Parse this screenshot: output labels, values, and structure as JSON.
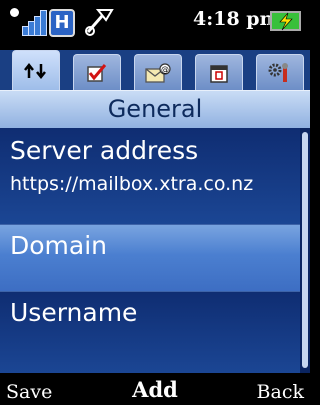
{
  "status_bar": {
    "time": "4:18 pm",
    "network_label": "H",
    "icons": [
      "signal-icon",
      "hsdpa-icon",
      "sync-icon",
      "battery-charging-icon"
    ]
  },
  "tabs": [
    {
      "name": "connection",
      "icon": "sync-arrows-icon",
      "active": true
    },
    {
      "name": "tasks",
      "icon": "checkbox-icon",
      "active": false
    },
    {
      "name": "email",
      "icon": "email-icon",
      "active": false
    },
    {
      "name": "calendar",
      "icon": "calendar-icon",
      "active": false
    },
    {
      "name": "settings",
      "icon": "settings-icon",
      "active": false
    }
  ],
  "title": "General",
  "items": [
    {
      "label": "Server address",
      "value": "https://mailbox.xtra.co.nz"
    },
    {
      "label": "Domain",
      "value": "",
      "selected": true
    },
    {
      "label": "Username",
      "value": ""
    }
  ],
  "softkeys": {
    "left": "Save",
    "middle": "Add",
    "right": "Back"
  },
  "colors": {
    "list_bg": "#0f2d72",
    "title_bg": "#a9c3ea",
    "selected_bg": "#5a8ad6"
  }
}
